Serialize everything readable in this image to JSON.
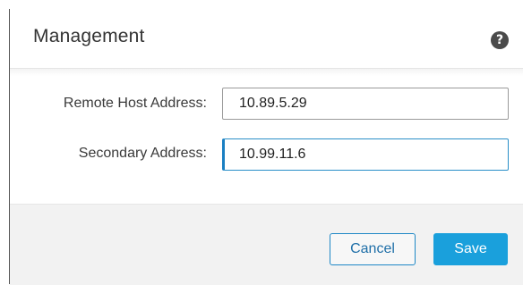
{
  "dialog": {
    "title": "Management",
    "help_icon_glyph": "?"
  },
  "form": {
    "remote_host": {
      "label": "Remote Host Address:",
      "value": "10.89.5.29"
    },
    "secondary": {
      "label": "Secondary Address:",
      "value": "10.99.11.6"
    }
  },
  "footer": {
    "cancel_label": "Cancel",
    "save_label": "Save"
  },
  "colors": {
    "primary_button": "#1aa0dc",
    "focus_border": "#1a7fc2",
    "footer_bg": "#f2f2f2"
  },
  "icons": {
    "help": "question-circle-icon"
  }
}
